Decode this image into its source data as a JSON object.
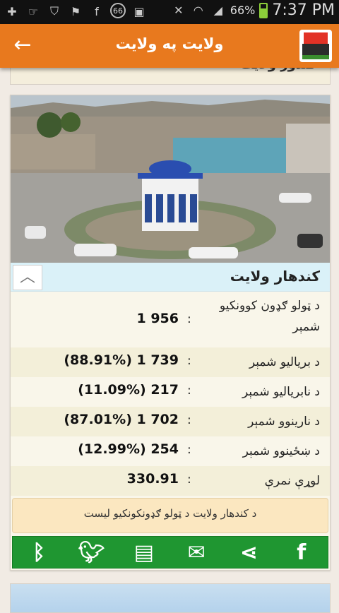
{
  "status_bar": {
    "battery_percent": "66%",
    "time": "7:37 PM",
    "badge_count": "66",
    "icons": [
      "add-icon",
      "hands-icon",
      "shield-icon",
      "signpost-icon",
      "facebook-icon",
      "badge-icon",
      "image-icon",
      "mute-icon",
      "wifi-icon",
      "signal-icon",
      "battery-icon"
    ]
  },
  "app_bar": {
    "title": "ولایت په ولایت",
    "back_icon": "arrow-left-icon",
    "logo_icon": "ballot-box-icon",
    "accent_color": "#e8791e"
  },
  "previous_card": {
    "label": "کندوز ولایت"
  },
  "province_card": {
    "name": "کندهار ولایت",
    "collapse_icon": "chevron-up-icon",
    "stats": [
      {
        "label": "د ټولو ګډون کوونکیو شمېر",
        "value": "1 956"
      },
      {
        "label": "د بریالیو شمېر",
        "value": "(88.91%)  1 739"
      },
      {
        "label": "د نابریالیو شمېر",
        "value": "(11.09%)  217"
      },
      {
        "label": "د نارینوو شمېر",
        "value": "(87.01%)  1 702"
      },
      {
        "label": "د ښځینوو شمېر",
        "value": "(12.99%)  254"
      },
      {
        "label": "لوړې نمرې",
        "value": "330.91"
      }
    ],
    "list_button": "د کندهار ولایت د ټولو ګډونکونکیو لیست",
    "share_icons": [
      "bluetooth-icon",
      "twitter-icon",
      "notes-icon",
      "email-icon",
      "share-icon",
      "facebook-icon"
    ],
    "share_color": "#1f9631"
  }
}
